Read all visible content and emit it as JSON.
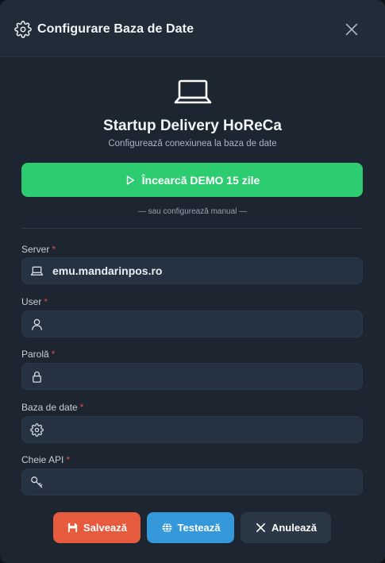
{
  "header": {
    "title": "Configurare Baza de Date"
  },
  "brand": {
    "title": "Startup Delivery HoReCa",
    "subtitle": "Configurează conexiunea la baza de date"
  },
  "demo": {
    "label": "Încearcă DEMO 15 zile"
  },
  "separator": {
    "text": "— sau configurează manual —"
  },
  "fields": {
    "server": {
      "label": "Server",
      "required": "*",
      "value": "emu.mandarinpos.ro",
      "icon": "laptop-icon"
    },
    "user": {
      "label": "User",
      "required": "*",
      "value": "",
      "icon": "user-icon"
    },
    "password": {
      "label": "Parolă",
      "required": "*",
      "value": "",
      "icon": "lock-icon"
    },
    "database": {
      "label": "Baza de date",
      "required": "*",
      "value": "",
      "icon": "gear-icon"
    },
    "api_key": {
      "label": "Cheie API",
      "required": "*",
      "value": "",
      "icon": "key-icon"
    }
  },
  "buttons": {
    "save": "Salvează",
    "test": "Testează",
    "cancel": "Anulează"
  },
  "colors": {
    "background": "#1c2530",
    "header": "#212c38",
    "demo": "#2ecc71",
    "save": "#e65a3e",
    "test": "#3498db",
    "cancel": "#2a3745",
    "required": "#e74c3c"
  }
}
